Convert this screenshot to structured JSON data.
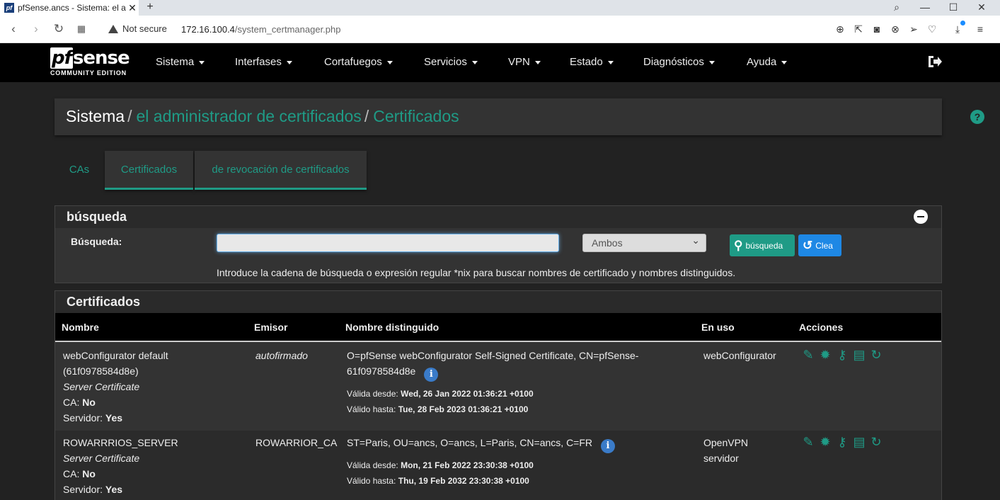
{
  "browser": {
    "tab_title": "pfSense.ancs - Sistema: el a",
    "favicon_text": "pf",
    "security_label": "Not secure",
    "url_host": "172.16.100.4",
    "url_path": "/system_certmanager.php"
  },
  "navbar": {
    "logo_text": "sense",
    "logo_pf": "pf",
    "logo_sub": "COMMUNITY EDITION",
    "items": [
      {
        "label": "Sistema"
      },
      {
        "label": "Interfases"
      },
      {
        "label": "Cortafuegos"
      },
      {
        "label": "Servicios"
      },
      {
        "label": "VPN"
      },
      {
        "label": "Estado"
      },
      {
        "label": "Diagnósticos"
      },
      {
        "label": "Ayuda"
      }
    ]
  },
  "breadcrumb": {
    "root": "Sistema",
    "level1": "el administrador de certificados",
    "level2": "Certificados",
    "separator": "/"
  },
  "tabs": [
    {
      "label": "CAs",
      "active": false
    },
    {
      "label": "Certificados",
      "active": true
    },
    {
      "label": "de revocación de certificados",
      "active": true
    }
  ],
  "search_panel": {
    "title": "búsqueda",
    "field_label": "Búsqueda:",
    "input_value": "",
    "select_value": "Ambos",
    "search_button": "búsqueda",
    "clear_button": "Clea",
    "help_text": "Introduce la cadena de búsqueda o expresión regular *nix para buscar nombres de certificado y nombres distinguidos."
  },
  "certs_panel": {
    "title": "Certificados",
    "columns": [
      "Nombre",
      "Emisor",
      "Nombre distinguido",
      "En uso",
      "Acciones"
    ],
    "rows": [
      {
        "name": "webConfigurator default",
        "name_id": "(61f0978584d8e)",
        "type": "Server Certificate",
        "ca_label": "CA:",
        "ca_value": "No",
        "server_label": "Servidor:",
        "server_value": "Yes",
        "issuer": "autofirmado",
        "dn_line1": "O=pfSense webConfigurator Self-Signed Certificate, CN=pfSense-",
        "dn_line2": "61f0978584d8e",
        "valid_from_label": "Válida desde:",
        "valid_from": "Wed, 26 Jan 2022 01:36:21 +0100",
        "valid_to_label": "Válido hasta:",
        "valid_to": "Tue, 28 Feb 2023 01:36:21 +0100",
        "in_use_1": "webConfigurator",
        "in_use_2": ""
      },
      {
        "name": "ROWARRRIOS_SERVER",
        "name_id": "",
        "type": "Server Certificate",
        "ca_label": "CA:",
        "ca_value": "No",
        "server_label": "Servidor:",
        "server_value": "Yes",
        "issuer": "ROWARRIOR_CA",
        "dn_line1": "ST=Paris, OU=ancs, O=ancs, L=Paris, CN=ancs, C=FR",
        "dn_line2": "",
        "valid_from_label": "Válida desde:",
        "valid_from": "Mon, 21 Feb 2022 23:30:38 +0100",
        "valid_to_label": "Válido hasta:",
        "valid_to": "Thu, 19 Feb 2032 23:30:38 +0100",
        "in_use_1": "OpenVPN",
        "in_use_2": "servidor"
      }
    ],
    "action_icons": [
      "pencil-icon",
      "certificate-icon",
      "key-icon",
      "archive-icon",
      "renew-icon"
    ]
  },
  "colors": {
    "accent": "#1f9b86",
    "info": "#3a7bc8",
    "clear_button": "#1e88e5"
  }
}
